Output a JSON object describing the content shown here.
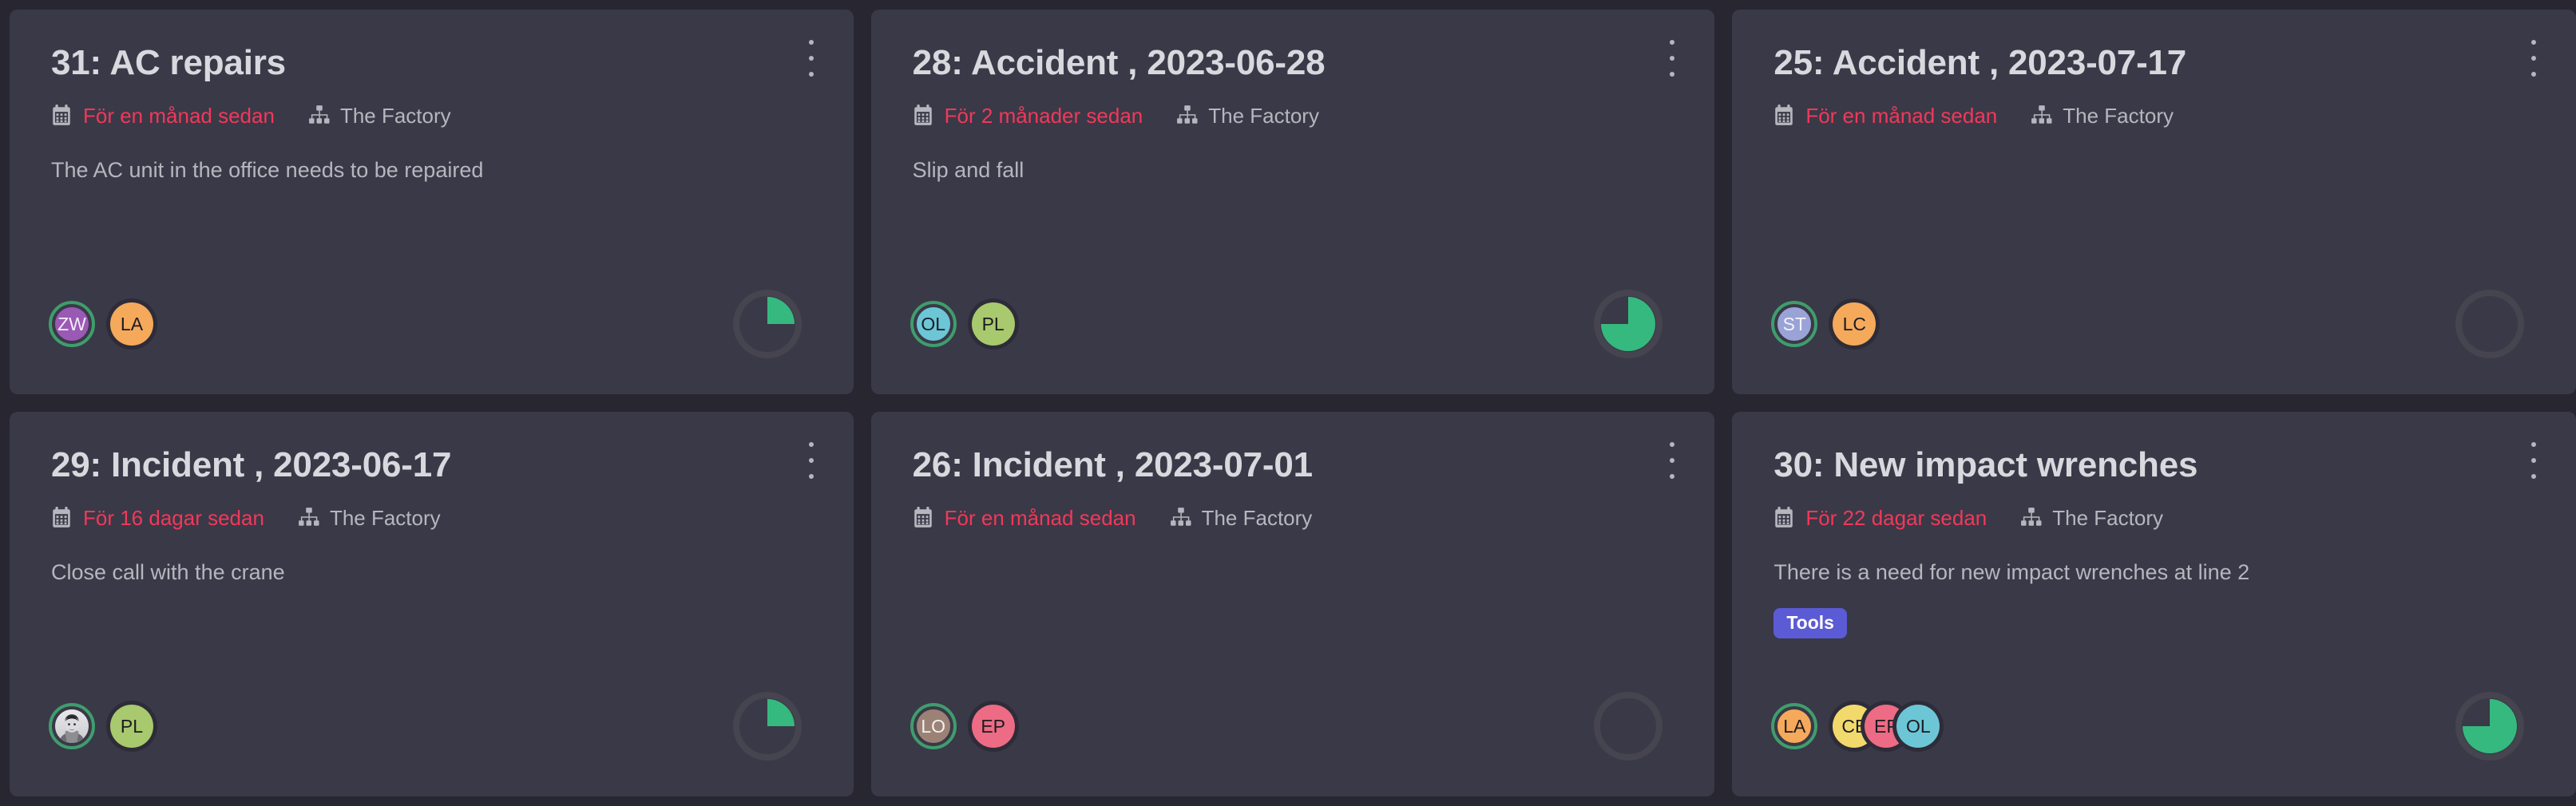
{
  "theme": {
    "page_background": "#272631",
    "card_background": "#3a3947",
    "title_color": "#d8d8de",
    "muted_text_color": "#b6b6bf",
    "date_accent_color": "#f2385a",
    "progress_fill_color": "#35b97f",
    "progress_track_color": "#45444f",
    "tag_color": "#5b5bd6",
    "avatar_active_ring_color": "#3f9d6d"
  },
  "icons": {
    "calendar": "calendar-icon",
    "organization": "sitemap-icon",
    "menu": "kebab-menu-icon"
  },
  "cards": [
    {
      "title": "31: AC repairs",
      "date_text": "För en månad sedan",
      "site_text": "The Factory",
      "description": "The AC unit in the office needs to be repaired",
      "tags": [],
      "progress_percent": 25,
      "avatars": [
        {
          "initials": "ZW",
          "color": "#9b59b6",
          "text_color": "#f3eef6",
          "active": true,
          "photo": false
        },
        {
          "initials": "LA",
          "color": "#f5a95b",
          "text_color": "#1b1b22",
          "active": false,
          "photo": false
        }
      ]
    },
    {
      "title": "28: Accident , 2023-06-28",
      "date_text": "För 2 månader sedan",
      "site_text": "The Factory",
      "description": "Slip and fall",
      "tags": [],
      "progress_percent": 75,
      "avatars": [
        {
          "initials": "OL",
          "color": "#6cc6d6",
          "text_color": "#1b1b22",
          "active": true,
          "photo": false
        },
        {
          "initials": "PL",
          "color": "#a8c96d",
          "text_color": "#1b1b22",
          "active": false,
          "photo": false
        }
      ]
    },
    {
      "title": "25: Accident , 2023-07-17",
      "date_text": "För en månad sedan",
      "site_text": "The Factory",
      "description": "",
      "tags": [],
      "progress_percent": 0,
      "avatars": [
        {
          "initials": "ST",
          "color": "#9aa3d6",
          "text_color": "#f3f3f8",
          "active": true,
          "photo": false
        },
        {
          "initials": "LC",
          "color": "#f5a95b",
          "text_color": "#1b1b22",
          "active": false,
          "photo": false
        }
      ]
    },
    {
      "title": "29: Incident , 2023-06-17",
      "date_text": "För 16 dagar sedan",
      "site_text": "The Factory",
      "description": "Close call with the crane",
      "tags": [],
      "progress_percent": 25,
      "avatars": [
        {
          "initials": "",
          "color": "#c9c9cf",
          "text_color": "#1b1b22",
          "active": true,
          "photo": true
        },
        {
          "initials": "PL",
          "color": "#a8c96d",
          "text_color": "#1b1b22",
          "active": false,
          "photo": false
        }
      ]
    },
    {
      "title": "26: Incident , 2023-07-01",
      "date_text": "För en månad sedan",
      "site_text": "The Factory",
      "description": "",
      "tags": [],
      "progress_percent": 0,
      "avatars": [
        {
          "initials": "LO",
          "color": "#9c8276",
          "text_color": "#f3f0ee",
          "active": true,
          "photo": false
        },
        {
          "initials": "EP",
          "color": "#ed6b84",
          "text_color": "#1b1b22",
          "active": false,
          "photo": false
        }
      ]
    },
    {
      "title": "30: New impact wrenches",
      "date_text": "För 22 dagar sedan",
      "site_text": "The Factory",
      "description": "There is a need for new impact wrenches at line 2",
      "tags": [
        "Tools"
      ],
      "progress_percent": 75,
      "avatars": [
        {
          "initials": "LA",
          "color": "#f5a95b",
          "text_color": "#1b1b22",
          "active": true,
          "photo": false
        },
        {
          "initials": "CB",
          "color": "#f2d96b",
          "text_color": "#1b1b22",
          "active": false,
          "photo": false
        },
        {
          "initials": "EP",
          "color": "#ed6b84",
          "text_color": "#1b1b22",
          "active": false,
          "photo": false
        },
        {
          "initials": "OL",
          "color": "#6cc6d6",
          "text_color": "#1b1b22",
          "active": false,
          "photo": false
        }
      ]
    }
  ]
}
